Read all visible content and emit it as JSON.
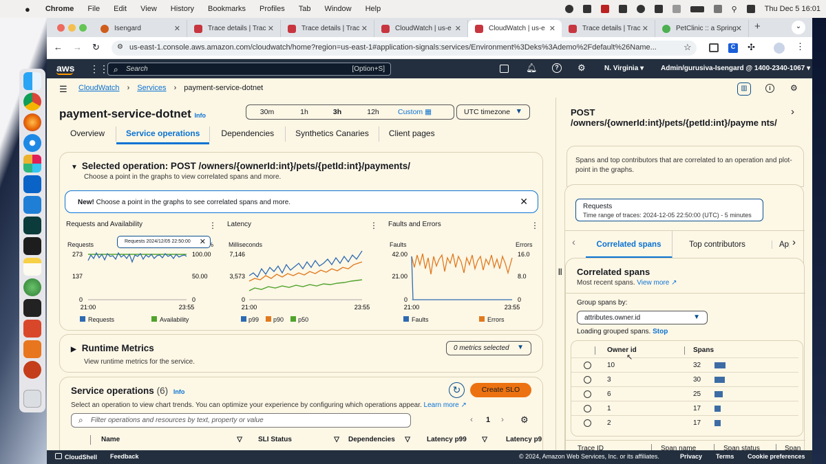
{
  "macbar": {
    "apple": "",
    "app": "Chrome",
    "menus": [
      "File",
      "Edit",
      "View",
      "History",
      "Bookmarks",
      "Profiles",
      "Tab",
      "Window",
      "Help"
    ],
    "clock": "Thu Dec 5  16:01"
  },
  "tabs": [
    {
      "label": "Isengard",
      "fav": "#d05c1b"
    },
    {
      "label": "Trace details | Trac",
      "fav": "#c7353f"
    },
    {
      "label": "Trace details | Trac",
      "fav": "#c7353f"
    },
    {
      "label": "CloudWatch | us-e",
      "fav": "#c7353f"
    },
    {
      "label": "CloudWatch | us-e",
      "fav": "#c7353f",
      "active": true
    },
    {
      "label": "Trace details | Trac",
      "fav": "#c7353f"
    },
    {
      "label": "PetClinic :: a Spring",
      "fav": "#4caf50"
    }
  ],
  "address": {
    "url": "us-east-1.console.aws.amazon.com/cloudwatch/home?region=us-east-1#application-signals:services/Environment%3Deks%3Ademo%2Fdefault%26Name..."
  },
  "awsnav": {
    "logo": "aws",
    "search_placeholder": "Search",
    "shortcut": "[Option+S]",
    "region": "N. Virginia",
    "account": "Admin/gurusiva-Isengard @ 1400-2340-1067"
  },
  "breadcrumb": {
    "item1": "CloudWatch",
    "item2": "Services",
    "current": "payment-service-dotnet"
  },
  "page": {
    "title": "payment-service-dotnet",
    "info": "Info"
  },
  "timerange": {
    "options": [
      "30m",
      "1h",
      "3h",
      "12h"
    ],
    "selected": "3h",
    "custom": "Custom",
    "timezone": "UTC timezone"
  },
  "tabs_main": [
    "Overview",
    "Service operations",
    "Dependencies",
    "Synthetics Canaries",
    "Client pages"
  ],
  "selected_op": {
    "title": "Selected operation: POST /owners/{ownerId:int}/pets/{petId:int}/payments/",
    "subtitle": "Choose a point in the graphs to view correlated spans and more.",
    "banner_new": "New!",
    "banner_text": " Choose a point in the graphs to see correlated spans and more."
  },
  "charts": {
    "c1": {
      "title": "Requests and Availability",
      "left_label": "Requests",
      "right_label": "%",
      "tooltip": "Requests 2024/12/05 22:50:00",
      "yl": [
        "273",
        "137",
        "0"
      ],
      "yr": [
        "100.00",
        "50.00",
        "0"
      ],
      "xs": [
        "21:00",
        "23:55"
      ],
      "legend": [
        "Requests",
        "Availability"
      ]
    },
    "c2": {
      "title": "Latency",
      "left_label": "Milliseconds",
      "yl": [
        "7,146",
        "3,573",
        "0"
      ],
      "xs": [
        "21:00",
        "23:55"
      ],
      "legend": [
        "p99",
        "p90",
        "p50"
      ]
    },
    "c3": {
      "title": "Faults and Errors",
      "left_label": "Faults",
      "right_label": "Errors",
      "yl": [
        "42.00",
        "21.00",
        "0"
      ],
      "yr": [
        "16.0",
        "8.0",
        "0"
      ],
      "xs": [
        "21:00",
        "23:55"
      ],
      "legend": [
        "Faults",
        "Errors"
      ]
    }
  },
  "colors": {
    "blue": "#2e6ab1",
    "orange": "#e07a1f",
    "green": "#50a32b",
    "awsdark": "#232f3e",
    "link": "#0972d3"
  },
  "runtime": {
    "title": "Runtime Metrics",
    "subtitle": "View runtime metrics for the service.",
    "select": "0 metrics selected"
  },
  "service_ops": {
    "title": "Service operations",
    "count": "(6)",
    "info": "Info",
    "desc": "Select an operation to view chart trends. You can optimize your experience by configuring which operations appear.",
    "learn": "Learn more",
    "create": "Create SLO",
    "filter_placeholder": "Filter operations and resources by text, property or value",
    "page": "1",
    "columns": [
      "Name",
      "SLI Status",
      "Dependencies",
      "Latency p99",
      "Latency p9"
    ]
  },
  "panel": {
    "title": "POST /owners/{ownerId:int}/pets/{petId:int}/payme nts/",
    "desc": "Spans and top contributors that are correlated to an operation and plot-point in the graphs.",
    "req_title": "Requests",
    "req_range": "Time range of traces: 2024-12-05 22:50:00 (UTC) - 5 minutes",
    "tabs": [
      "Correlated spans",
      "Top contributors",
      "App"
    ],
    "corr_title": "Correlated spans",
    "corr_sub": "Most recent spans.",
    "view_more": "View more",
    "group_label": "Group spans by:",
    "group_value": "attributes.owner.id",
    "loading": "Loading grouped spans.",
    "stop": "Stop",
    "col_owner": "Owner id",
    "col_spans": "Spans",
    "rows": [
      {
        "id": "10",
        "spans": "32",
        "frac": 0.5
      },
      {
        "id": "3",
        "spans": "30",
        "frac": 0.47
      },
      {
        "id": "6",
        "spans": "25",
        "frac": 0.39
      },
      {
        "id": "1",
        "spans": "17",
        "frac": 0.27
      },
      {
        "id": "2",
        "spans": "17",
        "frac": 0.27
      }
    ],
    "bottom_cols": [
      "Trace ID",
      "Span name",
      "Span status",
      "Span"
    ]
  },
  "footer": {
    "cloudshell": "CloudShell",
    "feedback": "Feedback",
    "copyright": "© 2024, Amazon Web Services, Inc. or its affiliates.",
    "privacy": "Privacy",
    "terms": "Terms",
    "cookies": "Cookie preferences"
  }
}
